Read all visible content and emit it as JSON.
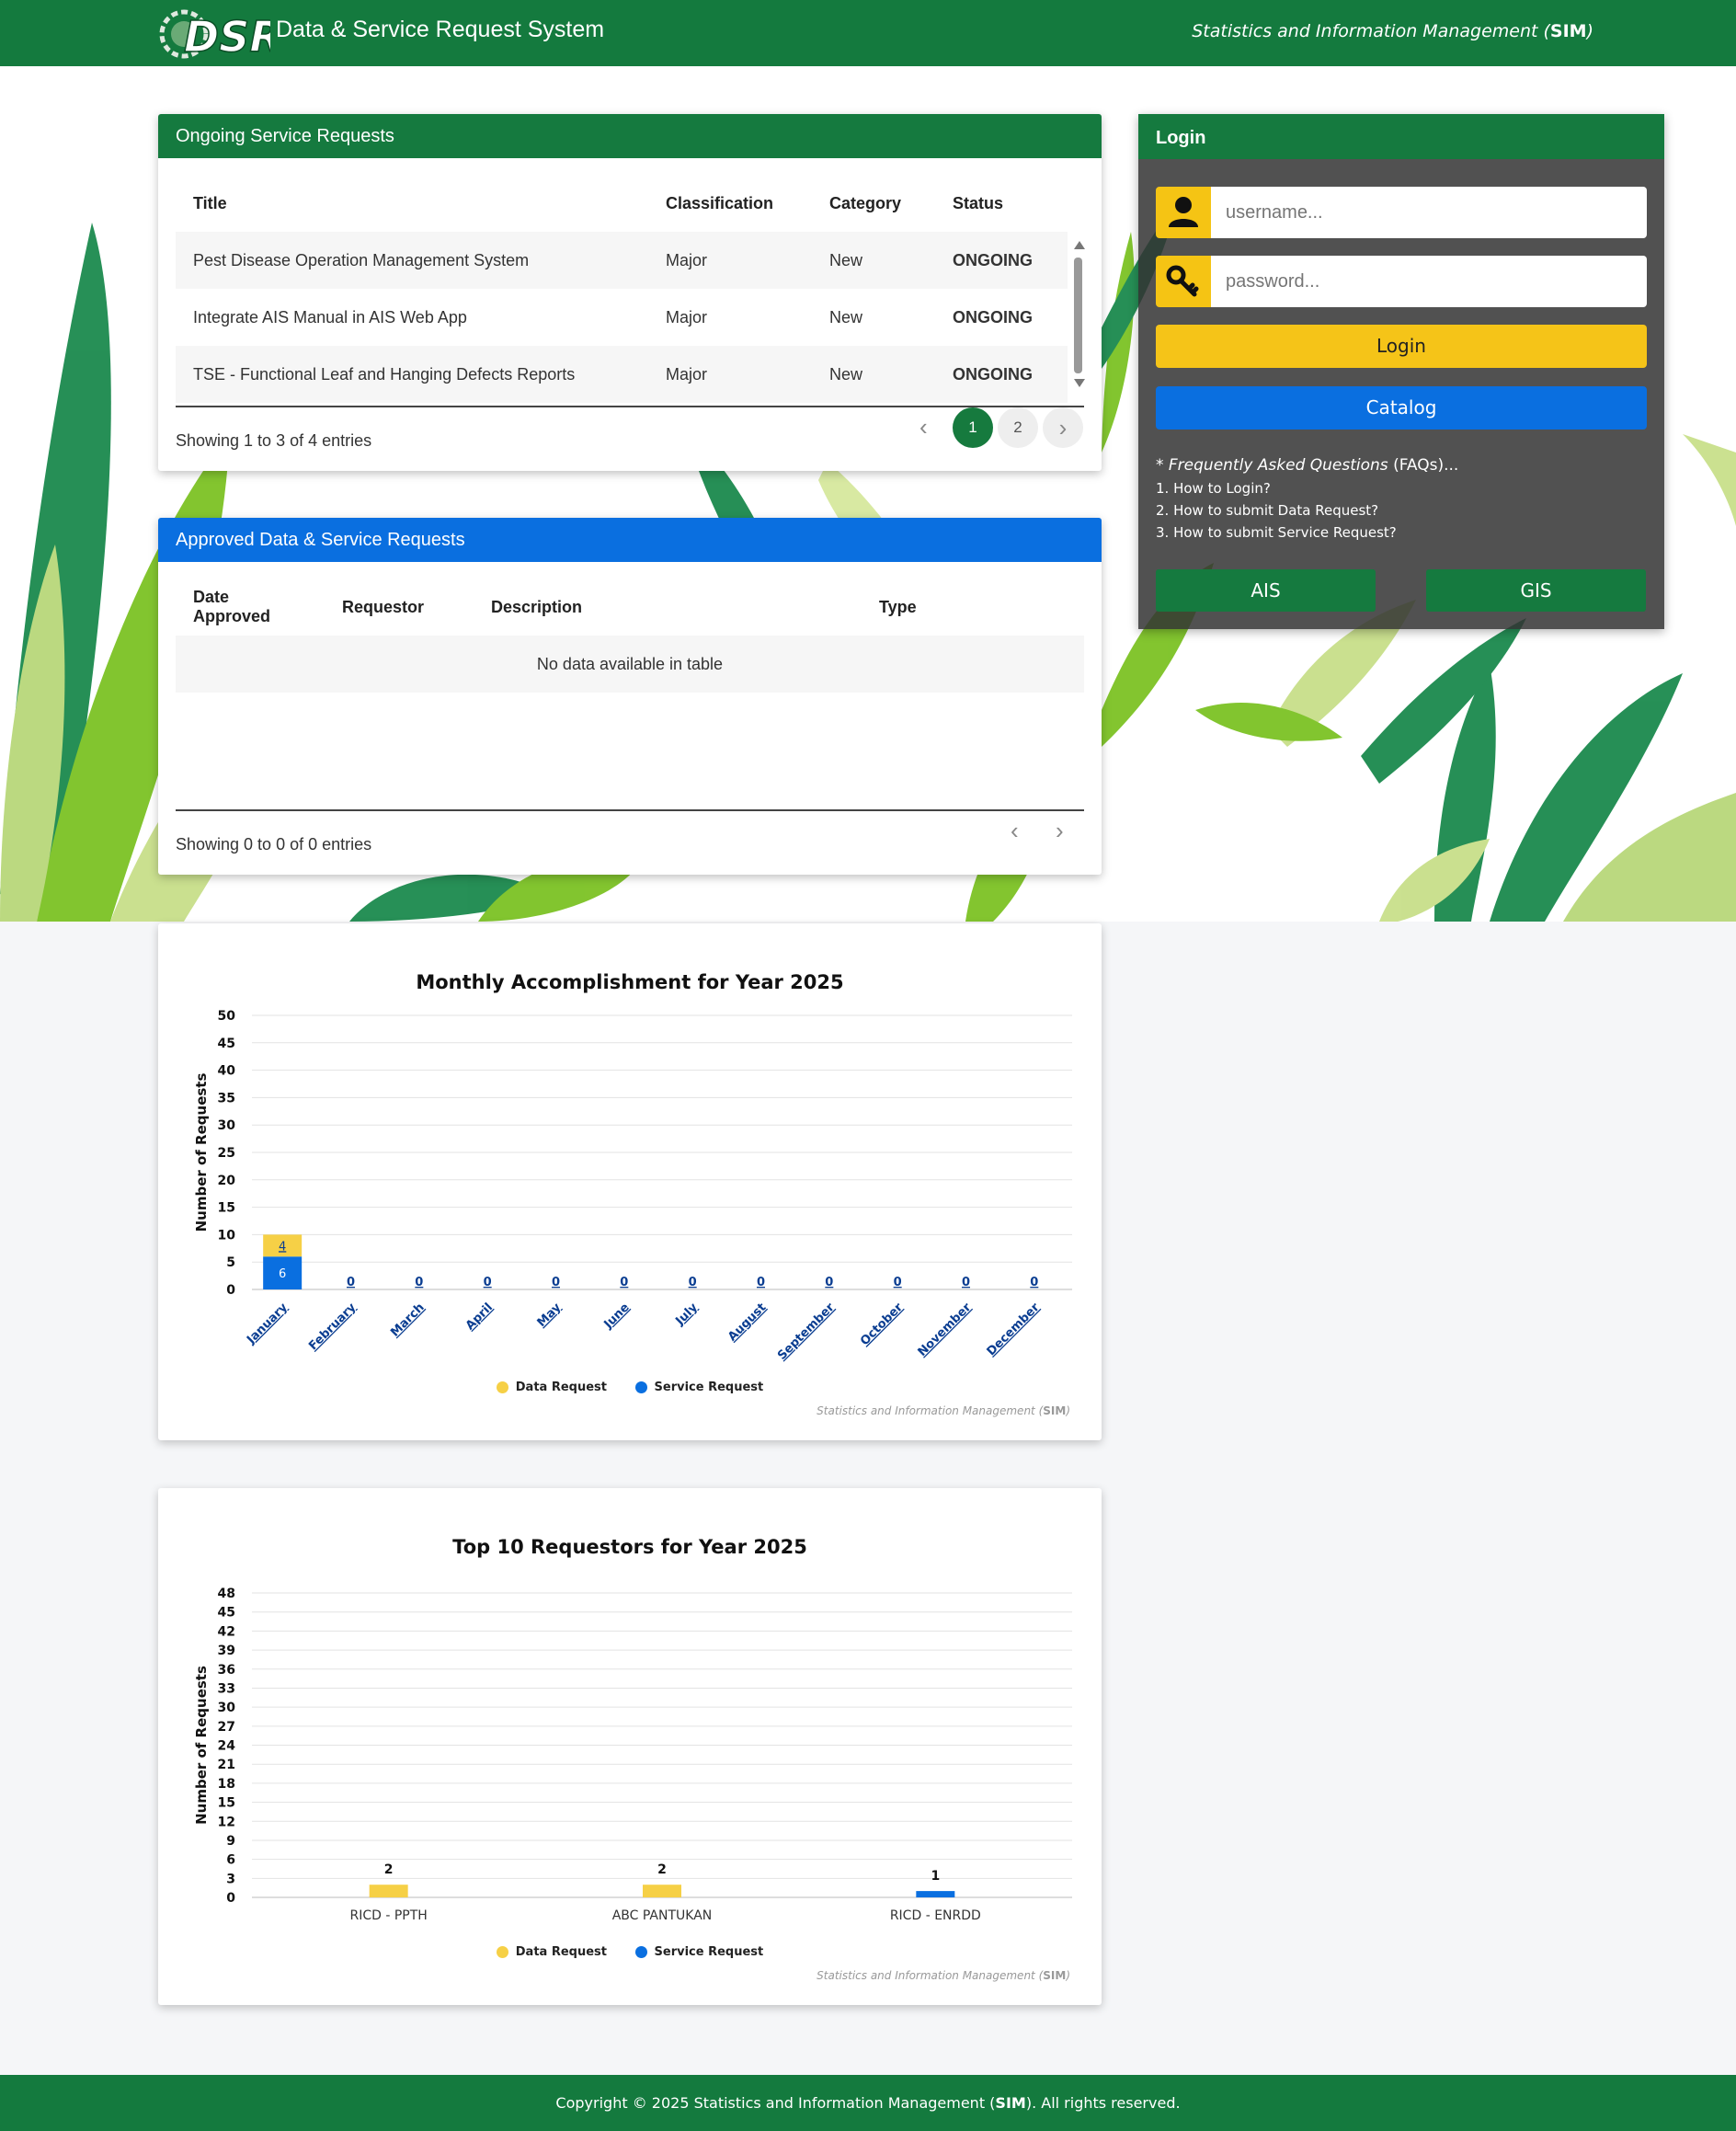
{
  "header": {
    "title": "Data & Service Request System",
    "org_prefix": "Statistics and Information Management (",
    "org_abbr": "SIM",
    "org_suffix": ")"
  },
  "ongoing": {
    "heading": "Ongoing Service Requests",
    "columns": [
      "Title",
      "Classification",
      "Category",
      "Status"
    ],
    "rows": [
      {
        "title": "Pest Disease Operation Management System",
        "classification": "Major",
        "category": "New",
        "status": "ONGOING"
      },
      {
        "title": "Integrate AIS Manual in AIS Web App",
        "classification": "Major",
        "category": "New",
        "status": "ONGOING"
      },
      {
        "title": "TSE - Functional Leaf and Hanging Defects Reports",
        "classification": "Major",
        "category": "New",
        "status": "ONGOING"
      }
    ],
    "showing": "Showing 1 to 3 of 4 entries",
    "pages": [
      "1",
      "2"
    ],
    "active_page": "1"
  },
  "approved": {
    "heading": "Approved Data & Service Requests",
    "columns": [
      "Date Approved",
      "Requestor",
      "Description",
      "Type"
    ],
    "empty": "No data available in table",
    "showing": "Showing 0 to 0 of 0 entries"
  },
  "login": {
    "heading": "Login",
    "username_placeholder": "username...",
    "password_placeholder": "password...",
    "login_label": "Login",
    "catalog_label": "Catalog",
    "faq_title": "* Frequently Asked Questions",
    "faq_abbr": "(FAQs)...",
    "faq_items": [
      "1. How to Login?",
      "2. How to submit Data Request?",
      "3. How to submit Service Request?"
    ],
    "ais_label": "AIS",
    "gis_label": "GIS"
  },
  "colors": {
    "brand_green": "#147a3e",
    "brand_blue": "#0a6fe0",
    "data_request": "#f6d046",
    "service_request": "#0a6fe0"
  },
  "chart_data": [
    {
      "type": "bar",
      "stacked": true,
      "title": "Monthly Accomplishment for Year 2025",
      "ylabel": "Number of Requests",
      "xlabel": "",
      "ylim": [
        0,
        50
      ],
      "yticks": [
        0,
        5,
        10,
        15,
        20,
        25,
        30,
        35,
        40,
        45,
        50
      ],
      "categories": [
        "January",
        "February",
        "March",
        "April",
        "May",
        "June",
        "July",
        "August",
        "September",
        "October",
        "November",
        "December"
      ],
      "series": [
        {
          "name": "Data Request",
          "values": [
            4,
            0,
            0,
            0,
            0,
            0,
            0,
            0,
            0,
            0,
            0,
            0
          ]
        },
        {
          "name": "Service Request",
          "values": [
            6,
            0,
            0,
            0,
            0,
            0,
            0,
            0,
            0,
            0,
            0,
            0
          ]
        }
      ],
      "zero_labels": [
        "0",
        "0",
        "0",
        "0",
        "0",
        "0",
        "0",
        "0",
        "0",
        "0",
        "0"
      ],
      "legend": [
        "Data Request",
        "Service Request"
      ],
      "legend_position": "bottom",
      "grid": true,
      "credit_prefix": "Statistics and Information Management (",
      "credit_abbr": "SIM",
      "credit_suffix": ")"
    },
    {
      "type": "bar",
      "stacked": false,
      "title": "Top 10 Requestors for Year 2025",
      "ylabel": "Number of Requests",
      "xlabel": "",
      "ylim": [
        0,
        48
      ],
      "yticks": [
        0,
        3,
        6,
        9,
        12,
        15,
        18,
        21,
        24,
        27,
        30,
        33,
        36,
        39,
        42,
        45,
        48
      ],
      "categories": [
        "RICD - PPTH",
        "ABC PANTUKAN",
        "RICD - ENRDD"
      ],
      "series": [
        {
          "name": "Data Request",
          "values": [
            2,
            2,
            0
          ]
        },
        {
          "name": "Service Request",
          "values": [
            0,
            0,
            1
          ]
        }
      ],
      "legend": [
        "Data Request",
        "Service Request"
      ],
      "legend_position": "bottom",
      "grid": true,
      "credit_prefix": "Statistics and Information Management (",
      "credit_abbr": "SIM",
      "credit_suffix": ")"
    }
  ],
  "footer": {
    "prefix": "Copyright © 2025 Statistics and Information Management (",
    "abbr": "SIM",
    "suffix": "). All rights reserved."
  }
}
